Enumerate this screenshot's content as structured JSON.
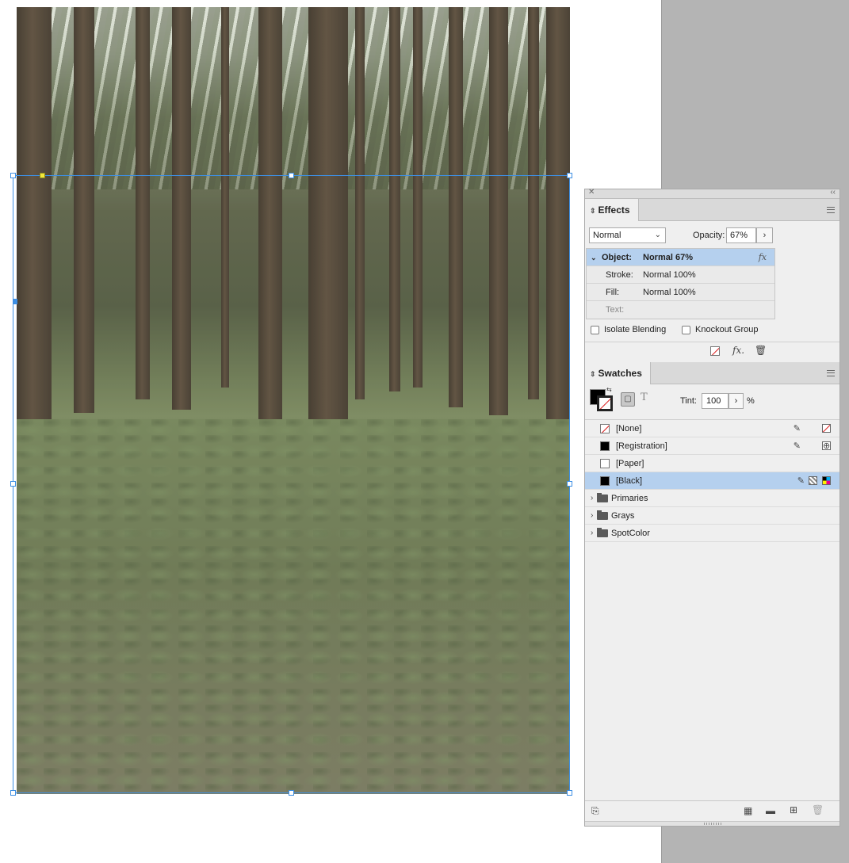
{
  "effects": {
    "tab_label": "Effects",
    "blend_mode": "Normal",
    "opacity_label": "Opacity:",
    "opacity_value": "67%",
    "rows": [
      {
        "label": "Object:",
        "value": "Normal 67%"
      },
      {
        "label": "Stroke:",
        "value": "Normal 100%"
      },
      {
        "label": "Fill:",
        "value": "Normal 100%"
      },
      {
        "label": "Text:",
        "value": ""
      }
    ],
    "isolate_blending_label": "Isolate Blending",
    "knockout_group_label": "Knockout Group",
    "fx_glyph": "fx"
  },
  "swatches": {
    "tab_label": "Swatches",
    "tint_label": "Tint:",
    "tint_value": "100",
    "tint_unit": "%",
    "text_glyph": "T",
    "items": [
      {
        "name": "[None]"
      },
      {
        "name": "[Registration]"
      },
      {
        "name": "[Paper]"
      },
      {
        "name": "[Black]"
      }
    ],
    "groups": [
      {
        "name": "Primaries"
      },
      {
        "name": "Grays"
      },
      {
        "name": "SpotColor"
      }
    ]
  },
  "icons": {
    "close": "close-icon",
    "collapse": "collapse-icon",
    "panel_menu": "hamburger-menu-icon",
    "clear_effects": "clear-effects-icon",
    "add_effect": "fx-icon",
    "delete": "trash-icon",
    "non_editable": "pencil-crossed-icon",
    "folder": "folder-icon",
    "new_swatch": "new-swatch-icon",
    "new_group": "new-folder-icon",
    "swatch_views": "swatch-view-icon",
    "load_swatches": "load-swatches-icon"
  },
  "colors": {
    "selection_blue": "#3d8fe4",
    "row_highlight": "#b5d0ee",
    "pasteboard": "#b4b4b4",
    "panel_bg": "#efefef"
  }
}
